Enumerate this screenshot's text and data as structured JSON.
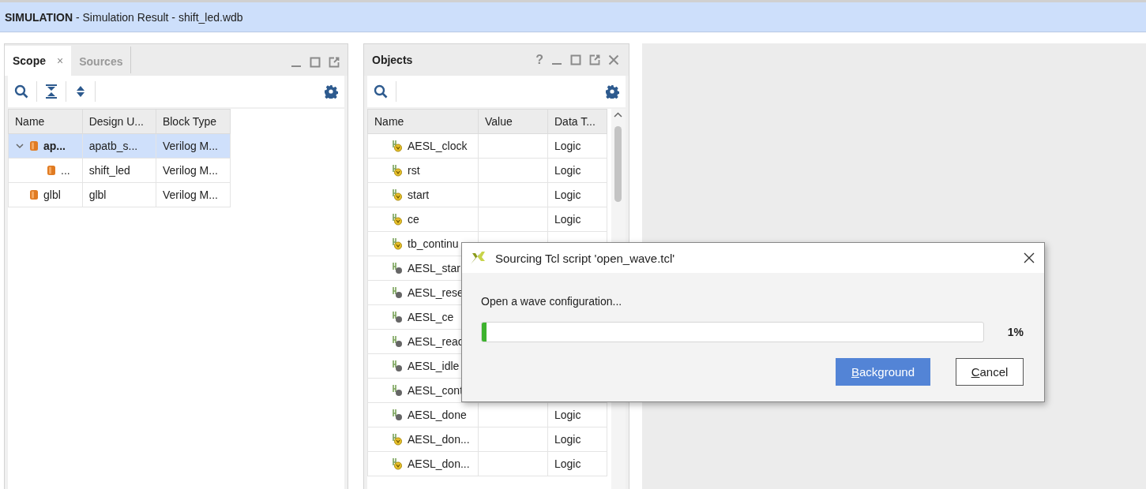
{
  "title_bar": {
    "mode": "SIMULATION",
    "title": " - Simulation Result - shift_led.wdb"
  },
  "scope_panel": {
    "tabs": [
      {
        "label": "Scope",
        "selected": true,
        "close": "×"
      },
      {
        "label": "Sources",
        "selected": false
      }
    ],
    "columns": [
      "Name",
      "Design U...",
      "Block Type"
    ],
    "rows": [
      {
        "name": "ap...",
        "design_unit": "apatb_s...",
        "block_type": "Verilog M...",
        "selected": true,
        "expanded": true,
        "children": [
          {
            "name": "...",
            "design_unit": "shift_led",
            "block_type": "Verilog M...",
            "selected": false
          }
        ]
      },
      {
        "name": "glbl",
        "design_unit": "glbl",
        "block_type": "Verilog M...",
        "selected": false
      }
    ]
  },
  "objects_panel": {
    "title": "Objects",
    "help": "?",
    "columns": [
      "Name",
      "Value",
      "Data T..."
    ],
    "rows": [
      {
        "kind": "badge",
        "name": "AESL_clock",
        "data_type": "Logic"
      },
      {
        "kind": "badge",
        "name": "rst",
        "data_type": "Logic"
      },
      {
        "kind": "badge",
        "name": "start",
        "data_type": "Logic"
      },
      {
        "kind": "badge",
        "name": "ce",
        "data_type": "Logic"
      },
      {
        "kind": "badge",
        "name": "tb_continu"
      },
      {
        "kind": "dot",
        "name": "AESL_star"
      },
      {
        "kind": "dot",
        "name": "AESL_rese"
      },
      {
        "kind": "dot",
        "name": "AESL_ce"
      },
      {
        "kind": "dot",
        "name": "AESL_reac"
      },
      {
        "kind": "dot",
        "name": "AESL_idle"
      },
      {
        "kind": "dot",
        "name": "AESL_cont"
      },
      {
        "kind": "dot",
        "name": "AESL_done",
        "data_type": "Logic"
      },
      {
        "kind": "badge",
        "name": "AESL_don...",
        "data_type": "Logic"
      },
      {
        "kind": "badge",
        "name": "AESL_don...",
        "data_type": "Logic"
      }
    ]
  },
  "dialog": {
    "title": "Sourcing Tcl script 'open_wave.tcl'",
    "message": "Open a wave configuration...",
    "progress": {
      "level": 0.01,
      "reading": "1%"
    },
    "buttons": [
      {
        "label": "Background",
        "mnemonic_underlined": true,
        "default": true
      },
      {
        "label": "Cancel",
        "mnemonic_underlined": true,
        "default": false
      }
    ]
  }
}
